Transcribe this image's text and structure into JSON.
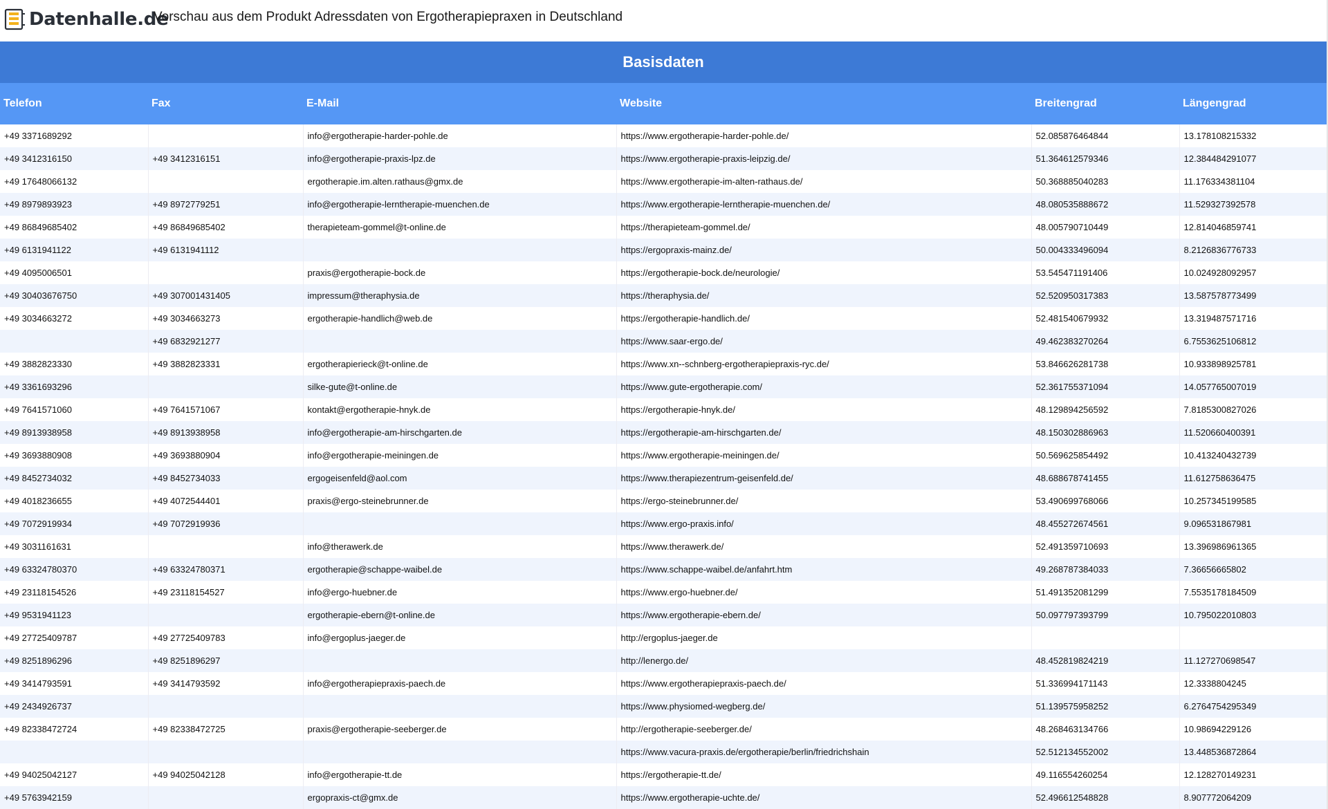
{
  "header": {
    "logo_text": "Datenhalle.de",
    "title": "Vorschau aus dem Produkt Adressdaten von Ergotherapiepraxen in Deutschland"
  },
  "section_title": "Basisdaten",
  "columns": [
    "Telefon",
    "Fax",
    "E-Mail",
    "Website",
    "Breitengrad",
    "Längengrad"
  ],
  "rows": [
    [
      "+49 3371689292",
      "",
      "info@ergotherapie-harder-pohle.de",
      "https://www.ergotherapie-harder-pohle.de/",
      "52.085876464844",
      "13.178108215332"
    ],
    [
      "+49 3412316150",
      "+49 3412316151",
      "info@ergotherapie-praxis-lpz.de",
      "https://www.ergotherapie-praxis-leipzig.de/",
      "51.364612579346",
      "12.384484291077"
    ],
    [
      "+49 17648066132",
      "",
      "ergotherapie.im.alten.rathaus@gmx.de",
      "https://www.ergotherapie-im-alten-rathaus.de/",
      "50.368885040283",
      "11.176334381104"
    ],
    [
      "+49 8979893923",
      "+49 8972779251",
      "info@ergotherapie-lerntherapie-muenchen.de",
      "https://www.ergotherapie-lerntherapie-muenchen.de/",
      "48.080535888672",
      "11.529327392578"
    ],
    [
      "+49 86849685402",
      "+49 86849685402",
      "therapieteam-gommel@t-online.de",
      "https://therapieteam-gommel.de/",
      "48.005790710449",
      "12.814046859741"
    ],
    [
      "+49 6131941122",
      "+49 6131941112",
      "",
      "https://ergopraxis-mainz.de/",
      "50.004333496094",
      "8.2126836776733"
    ],
    [
      "+49 4095006501",
      "",
      "praxis@ergotherapie-bock.de",
      "https://ergotherapie-bock.de/neurologie/",
      "53.545471191406",
      "10.024928092957"
    ],
    [
      "+49 30403676750",
      "+49 307001431405",
      "impressum@theraphysia.de",
      "https://theraphysia.de/",
      "52.520950317383",
      "13.587578773499"
    ],
    [
      "+49 3034663272",
      "+49 3034663273",
      "ergotherapie-handlich@web.de",
      "https://ergotherapie-handlich.de/",
      "52.481540679932",
      "13.319487571716"
    ],
    [
      "",
      "+49 6832921277",
      "",
      "https://www.saar-ergo.de/",
      "49.462383270264",
      "6.7553625106812"
    ],
    [
      "+49 3882823330",
      "+49 3882823331",
      "ergotherapierieck@t-online.de",
      "https://www.xn--schnberg-ergotherapiepraxis-ryc.de/",
      "53.846626281738",
      "10.933898925781"
    ],
    [
      "+49 3361693296",
      "",
      "silke-gute@t-online.de",
      "https://www.gute-ergotherapie.com/",
      "52.361755371094",
      "14.057765007019"
    ],
    [
      "+49 7641571060",
      "+49 7641571067",
      "kontakt@ergotherapie-hnyk.de",
      "https://ergotherapie-hnyk.de/",
      "48.129894256592",
      "7.8185300827026"
    ],
    [
      "+49 8913938958",
      "+49 8913938958",
      "info@ergotherapie-am-hirschgarten.de",
      "https://ergotherapie-am-hirschgarten.de/",
      "48.150302886963",
      "11.520660400391"
    ],
    [
      "+49 3693880908",
      "+49 3693880904",
      "info@ergotherapie-meiningen.de",
      "https://www.ergotherapie-meiningen.de/",
      "50.569625854492",
      "10.413240432739"
    ],
    [
      "+49 8452734032",
      "+49 8452734033",
      "ergogeisenfeld@aol.com",
      "https://www.therapiezentrum-geisenfeld.de/",
      "48.688678741455",
      "11.612758636475"
    ],
    [
      "+49 4018236655",
      "+49 4072544401",
      "praxis@ergo-steinebrunner.de",
      "https://ergo-steinebrunner.de/",
      "53.490699768066",
      "10.257345199585"
    ],
    [
      "+49 7072919934",
      "+49 7072919936",
      "",
      "https://www.ergo-praxis.info/",
      "48.455272674561",
      "9.096531867981"
    ],
    [
      "+49 3031161631",
      "",
      "info@therawerk.de",
      "https://www.therawerk.de/",
      "52.491359710693",
      "13.396986961365"
    ],
    [
      "+49 63324780370",
      "+49 63324780371",
      "ergotherapie@schappe-waibel.de",
      "https://www.schappe-waibel.de/anfahrt.htm",
      "49.268787384033",
      "7.36656665802"
    ],
    [
      "+49 23118154526",
      "+49 23118154527",
      "info@ergo-huebner.de",
      "https://www.ergo-huebner.de/",
      "51.491352081299",
      "7.5535178184509"
    ],
    [
      "+49 9531941123",
      "",
      "ergotherapie-ebern@t-online.de",
      "https://www.ergotherapie-ebern.de/",
      "50.097797393799",
      "10.795022010803"
    ],
    [
      "+49 27725409787",
      "+49 27725409783",
      "info@ergoplus-jaeger.de",
      "http://ergoplus-jaeger.de",
      "",
      ""
    ],
    [
      "+49 8251896296",
      "+49 8251896297",
      "",
      "http://lenergo.de/",
      "48.452819824219",
      "11.127270698547"
    ],
    [
      "+49 3414793591",
      "+49 3414793592",
      "info@ergotherapiepraxis-paech.de",
      "https://www.ergotherapiepraxis-paech.de/",
      "51.336994171143",
      "12.3338804245"
    ],
    [
      "+49 2434926737",
      "",
      "",
      "https://www.physiomed-wegberg.de/",
      "51.139575958252",
      "6.2764754295349"
    ],
    [
      "+49 82338472724",
      "+49 82338472725",
      "praxis@ergotherapie-seeberger.de",
      "http://ergotherapie-seeberger.de/",
      "48.268463134766",
      "10.98694229126"
    ],
    [
      "",
      "",
      "",
      "https://www.vacura-praxis.de/ergotherapie/berlin/friedrichshain",
      "52.512134552002",
      "13.448536872864"
    ],
    [
      "+49 94025042127",
      "+49 94025042128",
      "info@ergotherapie-tt.de",
      "https://ergotherapie-tt.de/",
      "49.116554260254",
      "12.128270149231"
    ],
    [
      "+49 5763942159",
      "",
      "ergopraxis-ct@gmx.de",
      "https://www.ergotherapie-uchte.de/",
      "52.496612548828",
      "8.907772064209"
    ]
  ]
}
